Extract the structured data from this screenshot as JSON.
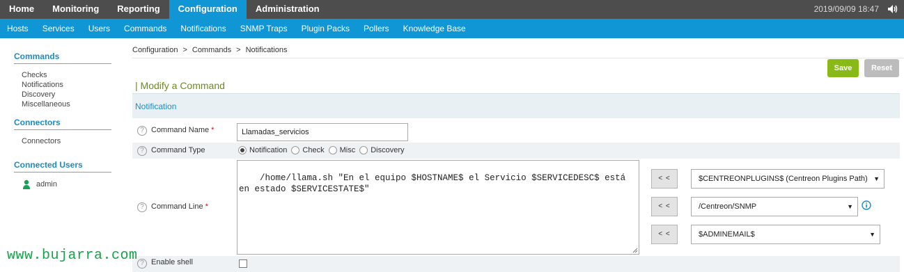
{
  "topnav": {
    "items": [
      "Home",
      "Monitoring",
      "Reporting",
      "Configuration",
      "Administration"
    ],
    "active": "Configuration",
    "clock": "2019/09/09 18:47"
  },
  "subnav": {
    "items": [
      "Hosts",
      "Services",
      "Users",
      "Commands",
      "Notifications",
      "SNMP Traps",
      "Plugin Packs",
      "Pollers",
      "Knowledge Base"
    ]
  },
  "sidebar": {
    "commands_title": "Commands",
    "commands_items": [
      "Checks",
      "Notifications",
      "Discovery",
      "Miscellaneous"
    ],
    "connectors_title": "Connectors",
    "connectors_items": [
      "Connectors"
    ],
    "users_title": "Connected Users",
    "user_name": "admin"
  },
  "breadcrumb": [
    "Configuration",
    "Commands",
    "Notifications"
  ],
  "buttons": {
    "save": "Save",
    "reset": "Reset"
  },
  "form": {
    "title": "| Modify a Command",
    "section": "Notification",
    "command_name_label": "Command Name",
    "command_name_value": "Llamadas_servicios",
    "command_type_label": "Command Type",
    "command_types": [
      "Notification",
      "Check",
      "Misc",
      "Discovery"
    ],
    "command_type_selected": "Notification",
    "command_line_label": "Command Line",
    "command_line_value": "/home/llama.sh \"En el equipo $HOSTNAME$ el Servicio $SERVICEDESC$ está en estado $SERVICESTATE$\"",
    "insert_button": "< <",
    "macro_selects": [
      "$CENTREONPLUGINS$ (Centreon Plugins Path)",
      "/Centreon/SNMP",
      "$ADMINEMAIL$"
    ],
    "enable_shell_label": "Enable shell",
    "required_marker": "*"
  },
  "watermark": "www.bujarra.com",
  "colors": {
    "topbar": "#4d4d4d",
    "accent": "#1096d4",
    "save": "#88b917",
    "reset": "#bcbcbc",
    "title": "#6b8c1c"
  }
}
